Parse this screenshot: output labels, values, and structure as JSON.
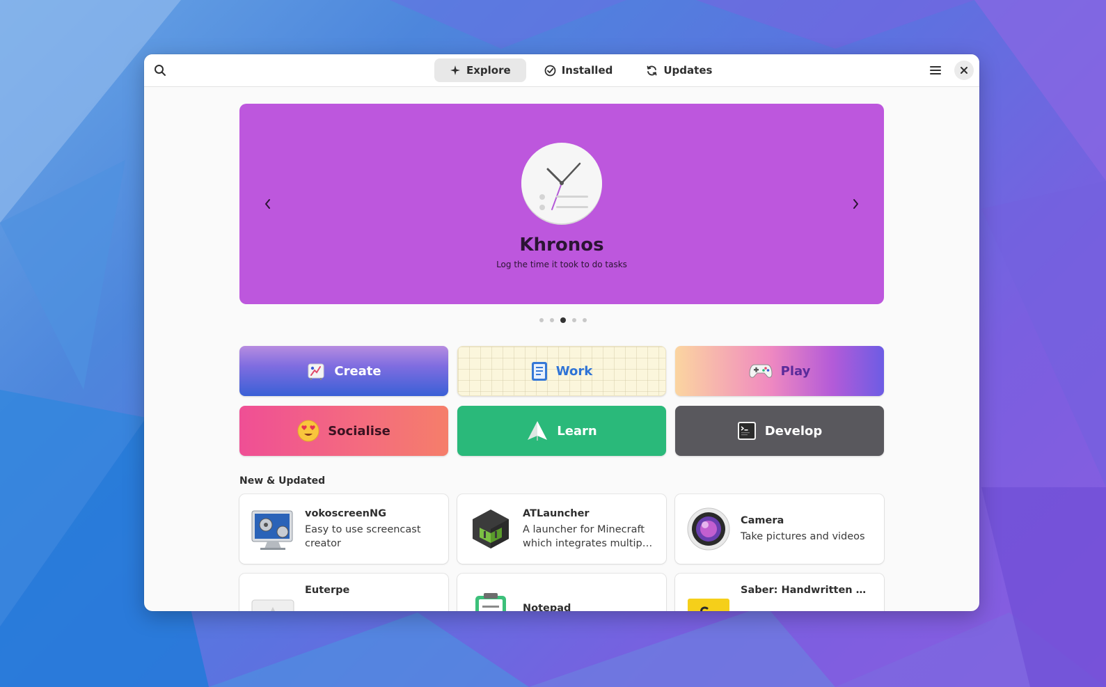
{
  "header": {
    "tabs": [
      {
        "label": "Explore",
        "icon": "sparkle-icon",
        "active": true
      },
      {
        "label": "Installed",
        "icon": "check-circle-icon",
        "active": false
      },
      {
        "label": "Updates",
        "icon": "refresh-icon",
        "active": false
      }
    ]
  },
  "featured": {
    "title": "Khronos",
    "subtitle": "Log the time it took to do tasks",
    "background": "#bd57dd",
    "slides": 5,
    "active_slide": 3
  },
  "categories": [
    {
      "label": "Create",
      "icon": "easel-icon"
    },
    {
      "label": "Work",
      "icon": "clipboard-icon"
    },
    {
      "label": "Play",
      "icon": "gamepad-icon"
    },
    {
      "label": "Socialise",
      "icon": "heart-eyes-emoji-icon"
    },
    {
      "label": "Learn",
      "icon": "paper-plane-icon"
    },
    {
      "label": "Develop",
      "icon": "terminal-icon"
    }
  ],
  "new_updated": {
    "title": "New & Updated",
    "apps": [
      {
        "name": "vokoscreenNG",
        "description": "Easy to use screencast creator",
        "icon": "monitor-film-icon"
      },
      {
        "name": "ATLauncher",
        "description": "A launcher for Minecraft which integrates multiple different modpacks",
        "icon": "cube-logo-icon"
      },
      {
        "name": "Camera",
        "description": "Take pictures and videos",
        "icon": "camera-lens-icon"
      },
      {
        "name": "Euterpe",
        "description": "",
        "icon": "music-player-icon"
      },
      {
        "name": "Notepad",
        "description": "",
        "icon": "notepad-icon"
      },
      {
        "name": "Saber: Handwritten Notes",
        "description": "",
        "icon": "saber-notes-icon"
      }
    ]
  }
}
